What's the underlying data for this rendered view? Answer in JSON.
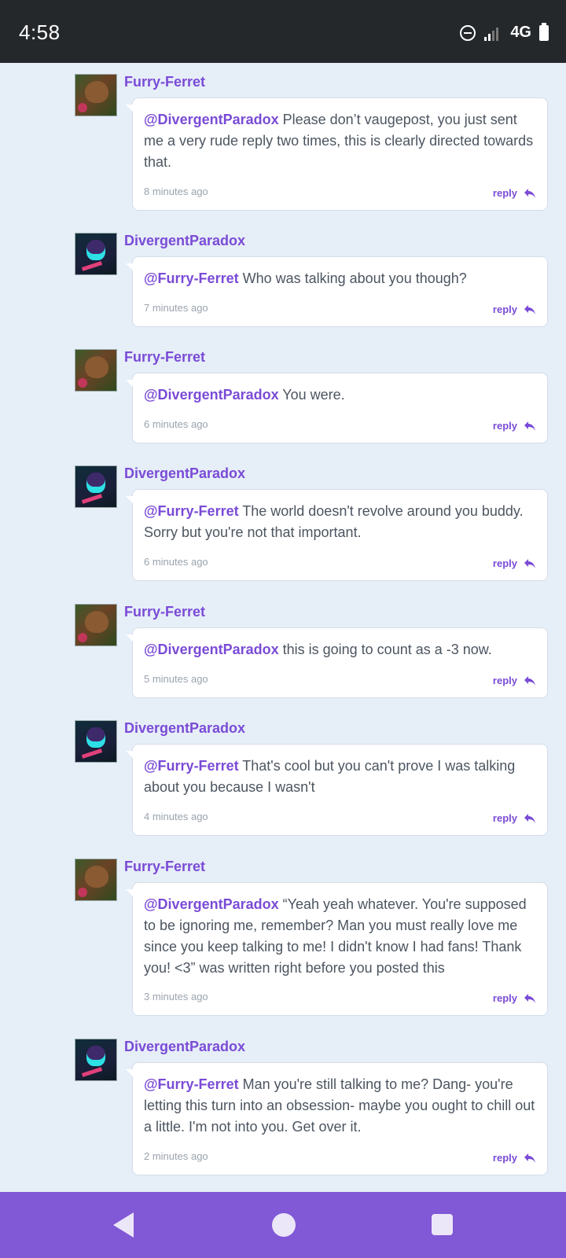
{
  "status_bar": {
    "time": "4:58",
    "network": "4G",
    "icons": [
      "do-not-disturb-icon",
      "signal-icon",
      "battery-icon"
    ]
  },
  "thread": {
    "comments": [
      {
        "author": "Furry-Ferret",
        "avatar": "ferret",
        "mention": "@DivergentParadox",
        "text": " Please don’t vaugepost, you just sent me a very rude reply two times, this is clearly directed towards that.",
        "time": "8 minutes ago",
        "reply_label": "reply"
      },
      {
        "author": "DivergentParadox",
        "avatar": "paradox",
        "mention": "@Furry-Ferret",
        "text": " Who was talking about you though?",
        "time": "7 minutes ago",
        "reply_label": "reply"
      },
      {
        "author": "Furry-Ferret",
        "avatar": "ferret",
        "mention": "@DivergentParadox",
        "text": " You were.",
        "time": "6 minutes ago",
        "reply_label": "reply"
      },
      {
        "author": "DivergentParadox",
        "avatar": "paradox",
        "mention": "@Furry-Ferret",
        "text": " The world doesn't revolve around you buddy. Sorry but you're not that important.",
        "time": "6 minutes ago",
        "reply_label": "reply"
      },
      {
        "author": "Furry-Ferret",
        "avatar": "ferret",
        "mention": "@DivergentParadox",
        "text": " this is going to count as a -3 now.",
        "time": "5 minutes ago",
        "reply_label": "reply"
      },
      {
        "author": "DivergentParadox",
        "avatar": "paradox",
        "mention": "@Furry-Ferret",
        "text": " That's cool but you can't prove I was talking about you because I wasn't",
        "time": "4 minutes ago",
        "reply_label": "reply"
      },
      {
        "author": "Furry-Ferret",
        "avatar": "ferret",
        "mention": "@DivergentParadox",
        "text": " “Yeah yeah whatever. You're supposed to be ignoring me, remember? Man you must really love me since you keep talking to me! I didn't know I had fans! Thank you! <3” was written right before you posted this",
        "time": "3 minutes ago",
        "reply_label": "reply"
      },
      {
        "author": "DivergentParadox",
        "avatar": "paradox",
        "mention": "@Furry-Ferret",
        "text": " Man you're still talking to me? Dang- you're letting this turn into an obsession- maybe you ought to chill out a little. I'm not into you. Get over it.",
        "time": "2 minutes ago",
        "reply_label": "reply"
      }
    ]
  },
  "nav_bar": {
    "icons": [
      "back-icon",
      "home-icon",
      "recent-apps-icon"
    ]
  }
}
